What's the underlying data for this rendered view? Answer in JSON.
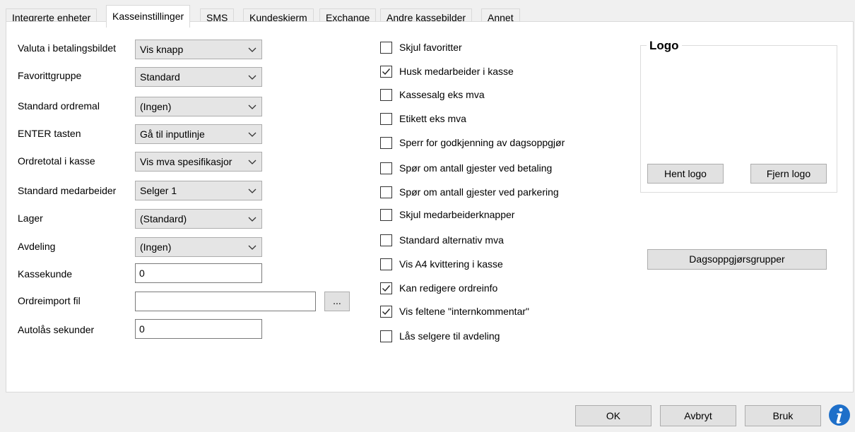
{
  "tabs": [
    {
      "label": "Integrerte enheter"
    },
    {
      "label": "Kasseinstillinger"
    },
    {
      "label": "SMS"
    },
    {
      "label": "Kundeskjerm"
    },
    {
      "label": "Exchange"
    },
    {
      "label": "Andre kassebilder"
    },
    {
      "label": "Annet"
    }
  ],
  "form": {
    "valuta": {
      "label": "Valuta i betalingsbildet",
      "value": "Vis knapp"
    },
    "favorittgruppe": {
      "label": "Favorittgruppe",
      "value": "Standard"
    },
    "ordremal": {
      "label": "Standard ordremal",
      "value": "(Ingen)"
    },
    "enter": {
      "label": "ENTER tasten",
      "value": "Gå til inputlinje"
    },
    "ordretotal": {
      "label": "Ordretotal i kasse",
      "value": "Vis mva spesifikasjor"
    },
    "medarbeider": {
      "label": "Standard medarbeider",
      "value": "Selger 1"
    },
    "lager": {
      "label": "Lager",
      "value": "(Standard)"
    },
    "avdeling": {
      "label": "Avdeling",
      "value": "(Ingen)"
    },
    "kassekunde": {
      "label": "Kassekunde",
      "value": "0"
    },
    "ordreimport": {
      "label": "Ordreimport fil",
      "value": "",
      "browse_label": "..."
    },
    "autolas": {
      "label": "Autolås sekunder",
      "value": "0"
    }
  },
  "checkboxes": [
    {
      "label": "Skjul favoritter",
      "checked": false
    },
    {
      "label": "Husk medarbeider i kasse",
      "checked": true
    },
    {
      "label": "Kassesalg eks mva",
      "checked": false
    },
    {
      "label": "Etikett eks mva",
      "checked": false
    },
    {
      "label": "Sperr for godkjenning av dagsoppgjør",
      "checked": false
    },
    {
      "label": "Spør om antall gjester ved betaling",
      "checked": false
    },
    {
      "label": "Spør om antall gjester ved parkering",
      "checked": false
    },
    {
      "label": "Skjul medarbeiderknapper",
      "checked": false
    },
    {
      "label": "Standard alternativ mva",
      "checked": false
    },
    {
      "label": "Vis A4 kvittering i kasse",
      "checked": false
    },
    {
      "label": "Kan redigere ordreinfo",
      "checked": true
    },
    {
      "label": "Vis feltene \"internkommentar\"",
      "checked": true
    },
    {
      "label": "Lås selgere til avdeling",
      "checked": false
    }
  ],
  "logo": {
    "title": "Logo",
    "hent_label": "Hent logo",
    "fjern_label": "Fjern logo"
  },
  "dagsoppgjor_label": "Dagsoppgjørsgrupper",
  "footer": {
    "ok_label": "OK",
    "avbryt_label": "Avbryt",
    "bruk_label": "Bruk"
  },
  "icons": {
    "info": "info-icon",
    "chevron": "chevron-down-icon",
    "check": "checkmark-icon"
  },
  "colors": {
    "info_blue": "#1e6fc9",
    "panel_bg": "#ffffff",
    "window_bg": "#f0f0f0"
  }
}
